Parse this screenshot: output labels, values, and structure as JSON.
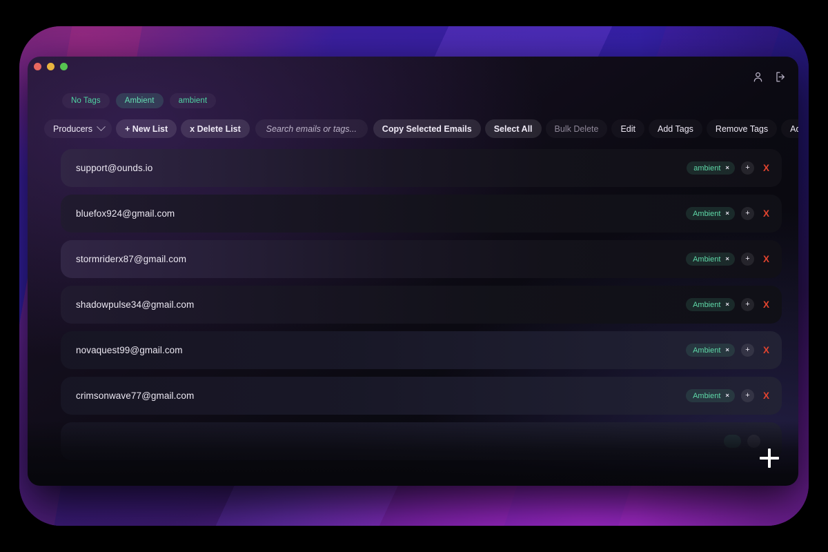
{
  "window": {
    "traffic_lights": [
      "close",
      "minimize",
      "maximize"
    ],
    "header_icons": [
      {
        "name": "user-icon",
        "label": "Account"
      },
      {
        "name": "logout-icon",
        "label": "Log out"
      }
    ]
  },
  "tag_filters": [
    {
      "label": "No Tags",
      "active": false
    },
    {
      "label": "Ambient",
      "active": true
    },
    {
      "label": "ambient",
      "active": false
    }
  ],
  "toolbar": {
    "list_select": {
      "label": "Producers",
      "icon": "chevron-down-icon"
    },
    "new_list": "+ New List",
    "delete_list": "x Delete List",
    "search": {
      "value": "",
      "placeholder": "Search emails or tags..."
    },
    "copy_selected": "Copy Selected Emails",
    "select_all": "Select All",
    "bulk_delete": "Bulk Delete",
    "edit": "Edit",
    "add_tags": "Add Tags",
    "remove_tags": "Remove Tags",
    "add_to_campaign": "Add to Campaign"
  },
  "rows": [
    {
      "email": "support@ounds.io",
      "tag": "ambient",
      "tag_remove": "×",
      "add": "+",
      "delete": "X"
    },
    {
      "email": "bluefox924@gmail.com",
      "tag": "Ambient",
      "tag_remove": "×",
      "add": "+",
      "delete": "X"
    },
    {
      "email": "stormriderx87@gmail.com",
      "tag": "Ambient",
      "tag_remove": "×",
      "add": "+",
      "delete": "X"
    },
    {
      "email": "shadowpulse34@gmail.com",
      "tag": "Ambient",
      "tag_remove": "×",
      "add": "+",
      "delete": "X"
    },
    {
      "email": "novaquest99@gmail.com",
      "tag": "Ambient",
      "tag_remove": "×",
      "add": "+",
      "delete": "X"
    },
    {
      "email": "crimsonwave77@gmail.com",
      "tag": "Ambient",
      "tag_remove": "×",
      "add": "+",
      "delete": "X"
    },
    {
      "email": "",
      "tag": "",
      "tag_remove": "",
      "add": "",
      "delete": ""
    }
  ],
  "fab": {
    "name": "add-email-button",
    "glyph": "+"
  },
  "colors": {
    "accent_green": "#5fd9a8",
    "danger_red": "#e2442f",
    "text_primary": "#ece8f2",
    "text_muted": "#8e8798",
    "backdrop_purple": "#8a28b8",
    "backdrop_blue": "#3220a8"
  }
}
